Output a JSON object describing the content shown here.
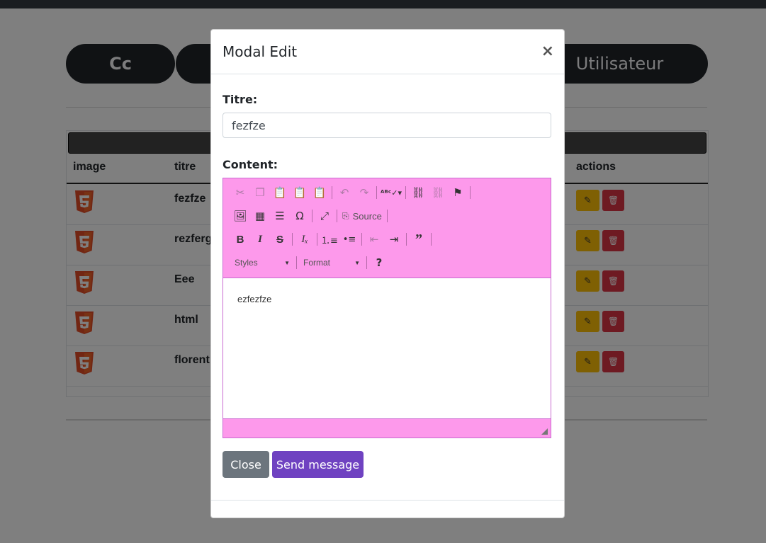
{
  "background": {
    "tabs": [
      {
        "label": "Cc"
      },
      {
        "label": ""
      },
      {
        "label": "Utilisateur"
      }
    ],
    "table": {
      "headers": {
        "image": "image",
        "titre": "titre",
        "actions": "actions"
      },
      "rows": [
        {
          "titre": "fezfze"
        },
        {
          "titre": "rezferg"
        },
        {
          "titre": "Eee"
        },
        {
          "titre": "html"
        },
        {
          "titre": "florent"
        }
      ]
    }
  },
  "modal": {
    "title": "Modal Edit",
    "close_symbol": "×",
    "titre_label": "Titre:",
    "titre_value": "fezfze",
    "content_label": "Content:",
    "editor": {
      "toolbar_row1": [
        "cut-icon",
        "copy-icon",
        "paste-icon",
        "paste-text-icon",
        "paste-word-icon",
        "undo-icon",
        "redo-icon",
        "spellcheck-icon",
        "link-icon",
        "unlink-icon",
        "anchor-flag-icon"
      ],
      "toolbar_row2": [
        "image-icon",
        "table-icon",
        "horizontal-rule-icon",
        "special-char-icon",
        "maximize-icon",
        "source-icon"
      ],
      "source_label": "Source",
      "toolbar_row3": [
        "bold-icon",
        "italic-icon",
        "strike-icon",
        "remove-format-icon",
        "numbered-list-icon",
        "bulleted-list-icon",
        "outdent-icon",
        "indent-icon",
        "blockquote-icon"
      ],
      "styles_label": "Styles",
      "format_label": "Format",
      "help_symbol": "?",
      "content_text": "ezfezfze"
    },
    "close_button": "Close",
    "send_button": "Send message"
  },
  "colors": {
    "editor_toolbar": "#fd99eb",
    "send_button": "#6f42c1",
    "close_button": "#6c757d",
    "edit_button": "#ffc107",
    "delete_button": "#dc3545"
  }
}
